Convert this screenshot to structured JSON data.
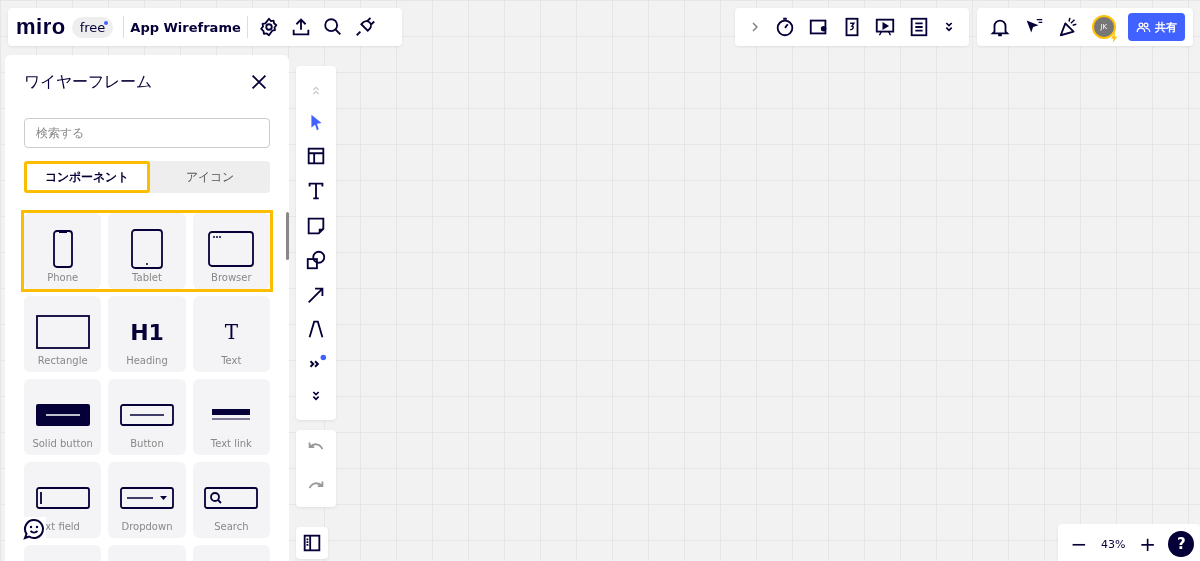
{
  "topbar": {
    "logo": "miro",
    "plan": "free",
    "board_title": "App Wireframe"
  },
  "avatar": {
    "initials": "JK"
  },
  "share_button": {
    "label": "共有"
  },
  "panel": {
    "title": "ワイヤーフレーム",
    "search": {
      "placeholder": "検索する"
    },
    "tabs": [
      {
        "label": "コンポーネント",
        "selected": true,
        "highlighted": true
      },
      {
        "label": "アイコン",
        "selected": false,
        "highlighted": false
      }
    ],
    "rows": [
      {
        "highlighted": true,
        "items": [
          {
            "kind": "phone",
            "label": "Phone"
          },
          {
            "kind": "tablet",
            "label": "Tablet"
          },
          {
            "kind": "browser",
            "label": "Browser"
          }
        ]
      },
      {
        "highlighted": false,
        "items": [
          {
            "kind": "rectangle",
            "label": "Rectangle"
          },
          {
            "kind": "heading",
            "label": "Heading",
            "glyph": "H1"
          },
          {
            "kind": "text",
            "label": "Text",
            "glyph": "T"
          }
        ]
      },
      {
        "highlighted": false,
        "items": [
          {
            "kind": "solid-button",
            "label": "Solid button"
          },
          {
            "kind": "button",
            "label": "Button"
          },
          {
            "kind": "text-link",
            "label": "Text link"
          }
        ]
      },
      {
        "highlighted": false,
        "items": [
          {
            "kind": "text-field",
            "label": "xt field"
          },
          {
            "kind": "dropdown",
            "label": "Dropdown"
          },
          {
            "kind": "search",
            "label": "Search"
          }
        ]
      },
      {
        "highlighted": false,
        "items": [
          {
            "kind": "blank"
          },
          {
            "kind": "blank"
          },
          {
            "kind": "blank"
          }
        ]
      }
    ]
  },
  "zoom": {
    "minus": "−",
    "level": "43%",
    "plus": "+",
    "help": "?"
  }
}
